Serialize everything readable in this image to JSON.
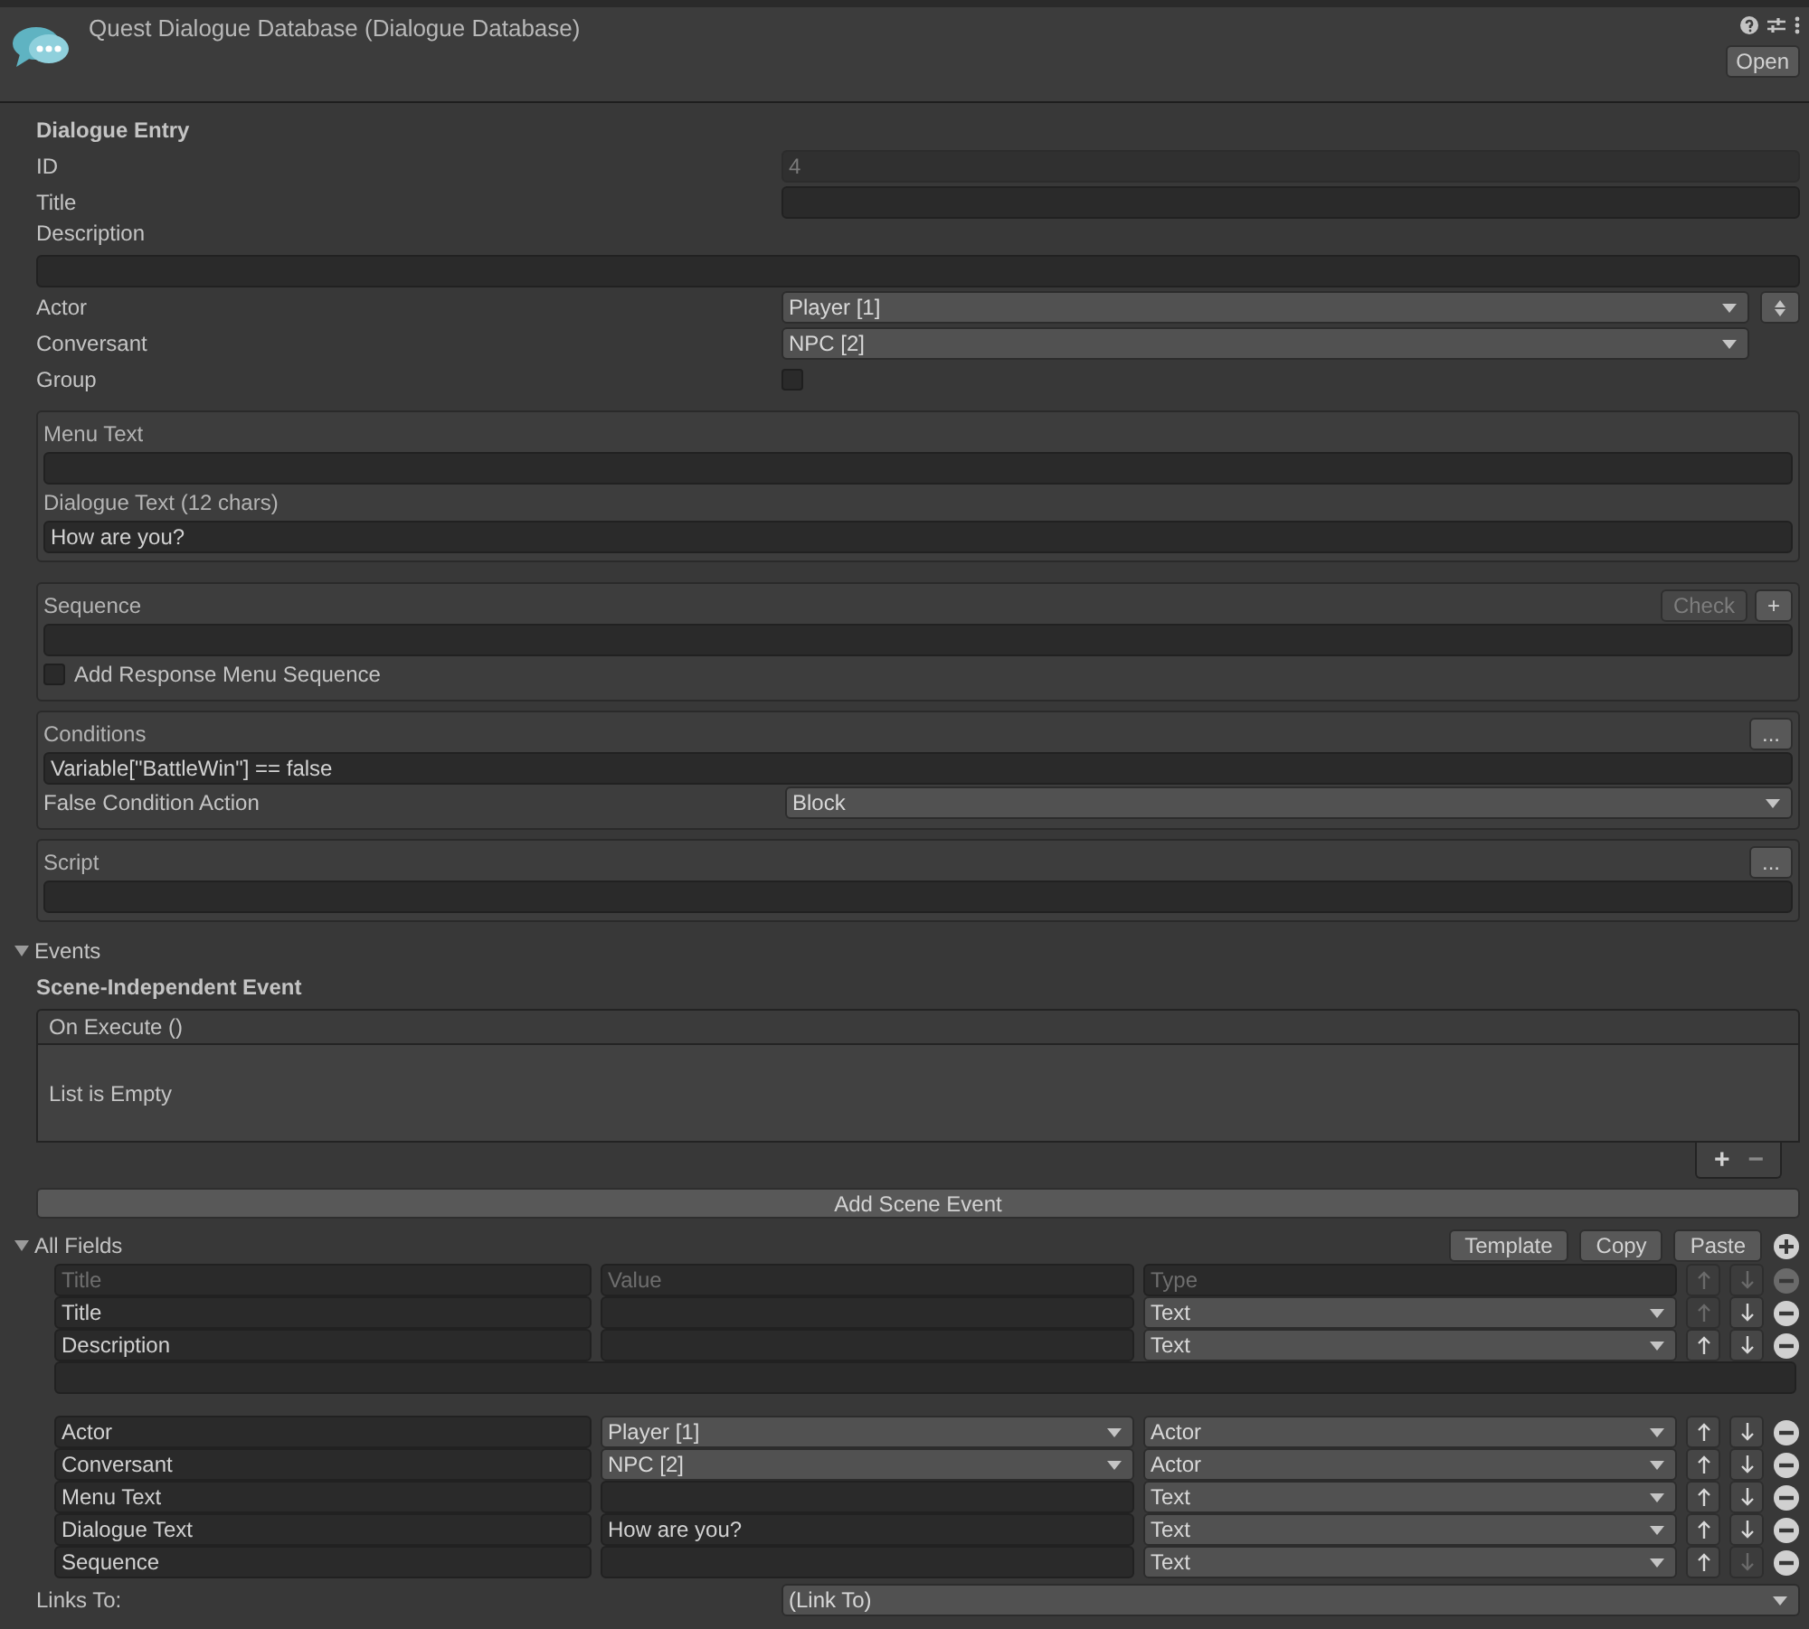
{
  "header": {
    "title": "Quest Dialogue Database (Dialogue Database)",
    "open_button": "Open"
  },
  "entry": {
    "heading": "Dialogue Entry",
    "fields": [
      {
        "kind": "text",
        "label": "ID",
        "value": "4",
        "disabled": true
      },
      {
        "kind": "text",
        "label": "Title"
      },
      {
        "kind": "wide_text",
        "label": "Description"
      },
      {
        "kind": "dropdown",
        "label": "Actor",
        "value": "Player [1]",
        "swap_button": true
      },
      {
        "kind": "dropdown",
        "label": "Conversant",
        "value": "NPC [2]",
        "swap_button": false
      },
      {
        "kind": "checkbox",
        "label": "Group",
        "checked": false
      }
    ]
  },
  "text_box": {
    "fields": [
      {
        "label": "Menu Text"
      },
      {
        "label": "Dialogue Text (12 chars)",
        "value": "How are you?"
      }
    ]
  },
  "sequence_box": {
    "label": "Sequence",
    "check_button": {
      "label": "Check",
      "disabled": true
    },
    "add_button": "+",
    "option": {
      "label": "Add Response Menu Sequence",
      "checked": false
    }
  },
  "conditions_box": {
    "label": "Conditions",
    "menu_button": "...",
    "value": "Variable[\"BattleWin\"] == false",
    "action_label": "False Condition Action",
    "action_value": "Block"
  },
  "script_box": {
    "label": "Script",
    "menu_button": "..."
  },
  "events": {
    "label": "Events",
    "expanded": true,
    "heading": "Scene-Independent Event",
    "list_header": "On Execute ()",
    "empty_text": "List is Empty",
    "add_button": "+",
    "remove_button": "−",
    "add_scene_event": "Add Scene Event"
  },
  "all_fields": {
    "label": "All Fields",
    "expanded": true,
    "buttons": [
      "Template",
      "Copy",
      "Paste"
    ],
    "rows": [
      {
        "kind": "header",
        "title_placeholder": "Title",
        "value_placeholder": "Value",
        "type_placeholder": "Type",
        "up_disabled": true,
        "down_disabled": true,
        "remove_disabled": true
      },
      {
        "kind": "field",
        "title": "Title",
        "value": {
          "kind": "text"
        },
        "type": "Text",
        "up_disabled": true,
        "down_disabled": false,
        "remove_disabled": false
      },
      {
        "kind": "field",
        "title": "Description",
        "value": {
          "kind": "text"
        },
        "type": "Text",
        "up_disabled": false,
        "down_disabled": false,
        "remove_disabled": false
      },
      {
        "kind": "wide"
      },
      {
        "kind": "field",
        "title": "Actor",
        "value": {
          "kind": "dropdown",
          "text": "Player [1]"
        },
        "type": "Actor",
        "up_disabled": false,
        "down_disabled": false,
        "remove_disabled": false
      },
      {
        "kind": "field",
        "title": "Conversant",
        "value": {
          "kind": "dropdown",
          "text": "NPC [2]"
        },
        "type": "Actor",
        "up_disabled": false,
        "down_disabled": false,
        "remove_disabled": false
      },
      {
        "kind": "field",
        "title": "Menu Text",
        "value": {
          "kind": "text"
        },
        "type": "Text",
        "up_disabled": false,
        "down_disabled": false,
        "remove_disabled": false
      },
      {
        "kind": "field",
        "title": "Dialogue Text",
        "value": {
          "kind": "text",
          "text": "How are you?"
        },
        "type": "Text",
        "up_disabled": false,
        "down_disabled": false,
        "remove_disabled": false
      },
      {
        "kind": "field",
        "title": "Sequence",
        "value": {
          "kind": "text"
        },
        "type": "Text",
        "up_disabled": false,
        "down_disabled": true,
        "remove_disabled": false
      }
    ]
  },
  "links_to": {
    "label": "Links To:",
    "value": "(Link To)"
  }
}
